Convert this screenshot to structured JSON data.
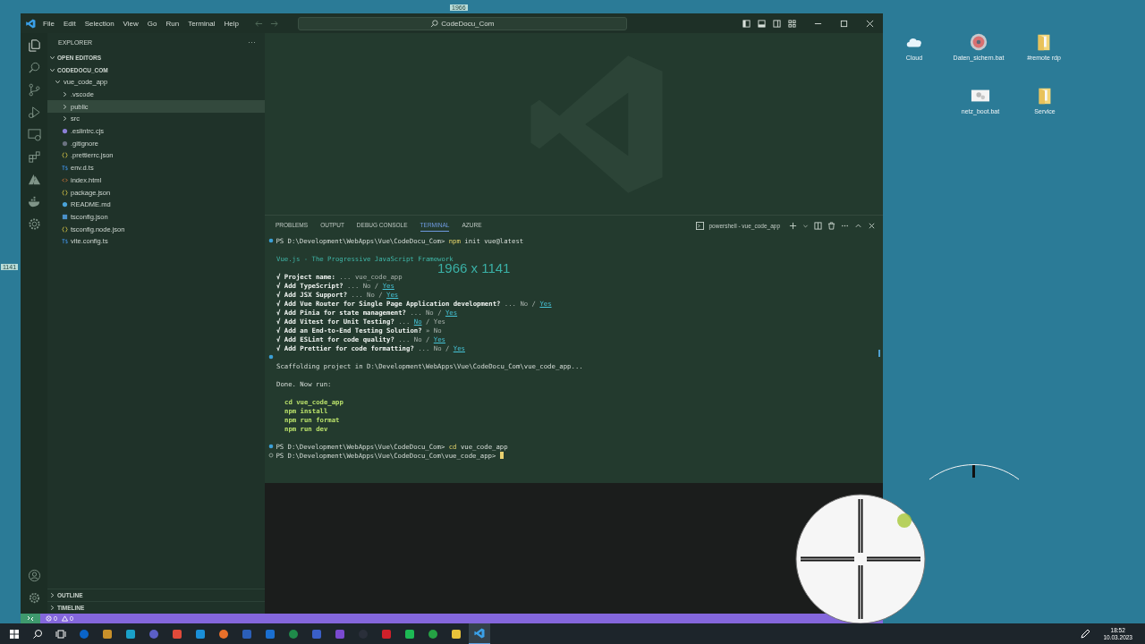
{
  "window": {
    "menu": [
      "File",
      "Edit",
      "Selection",
      "View",
      "Go",
      "Run",
      "Terminal",
      "Help"
    ],
    "command_center": "CodeDocu_Com"
  },
  "sidebar": {
    "title": "EXPLORER",
    "more": "···",
    "sections": [
      {
        "title": "OPEN EDITORS",
        "expanded": true
      },
      {
        "title": "CODEDOCU_COM",
        "expanded": true,
        "tree": [
          {
            "label": "vue_code_app",
            "kind": "folder",
            "expanded": true,
            "selected": false,
            "children": [
              {
                "label": ".vscode",
                "kind": "folder",
                "expanded": false,
                "selected": false
              },
              {
                "label": "public",
                "kind": "folder",
                "expanded": false,
                "selected": true
              },
              {
                "label": "src",
                "kind": "folder",
                "expanded": false,
                "selected": false
              },
              {
                "label": ".eslintrc.cjs",
                "kind": "eslint",
                "selected": false
              },
              {
                "label": ".gitignore",
                "kind": "git",
                "selected": false
              },
              {
                "label": ".prettierrc.json",
                "kind": "braces",
                "selected": false
              },
              {
                "label": "env.d.ts",
                "kind": "ts",
                "selected": false
              },
              {
                "label": "index.html",
                "kind": "html",
                "selected": false
              },
              {
                "label": "package.json",
                "kind": "braces",
                "selected": false
              },
              {
                "label": "README.md",
                "kind": "info",
                "selected": false
              },
              {
                "label": "tsconfig.json",
                "kind": "tsconfig",
                "selected": false
              },
              {
                "label": "tsconfig.node.json",
                "kind": "braces",
                "selected": false
              },
              {
                "label": "vite.config.ts",
                "kind": "ts",
                "selected": false
              }
            ]
          }
        ]
      }
    ],
    "bottom_sections": [
      {
        "title": "OUTLINE",
        "expanded": false
      },
      {
        "title": "TIMELINE",
        "expanded": false
      }
    ]
  },
  "panel": {
    "tabs": [
      {
        "label": "PROBLEMS",
        "selected": false
      },
      {
        "label": "OUTPUT",
        "selected": false
      },
      {
        "label": "DEBUG CONSOLE",
        "selected": false
      },
      {
        "label": "TERMINAL",
        "selected": true
      },
      {
        "label": "AZURE",
        "selected": false
      }
    ],
    "terminal_name": "powershell - vue_code_app",
    "lines": [
      {
        "kind": "prompt",
        "finished": true,
        "text": "PS D:\\Development\\WebApps\\Vue\\CodeDocu_Com>",
        "program": "npm",
        "args": "init vue@latest"
      },
      {
        "kind": "blank"
      },
      {
        "kind": "info",
        "text": "Vue.js - The Progressive JavaScript Framework"
      },
      {
        "kind": "blank"
      },
      {
        "kind": "answer",
        "mark": "√",
        "question": "Project name:",
        "answer": "... vue_code_app"
      },
      {
        "kind": "choice",
        "mark": "√",
        "question": "Add TypeScript?",
        "prefix": "...",
        "separator": "/",
        "options": [
          {
            "label": "No",
            "selected": false
          },
          {
            "label": "Yes",
            "selected": true
          }
        ]
      },
      {
        "kind": "choice",
        "mark": "√",
        "question": "Add JSX Support?",
        "prefix": "...",
        "separator": "/",
        "options": [
          {
            "label": "No",
            "selected": false
          },
          {
            "label": "Yes",
            "selected": true
          }
        ]
      },
      {
        "kind": "choice",
        "mark": "√",
        "question": "Add Vue Router for Single Page Application development?",
        "prefix": "...",
        "separator": "/",
        "options": [
          {
            "label": "No",
            "selected": false
          },
          {
            "label": "Yes",
            "selected": true
          }
        ]
      },
      {
        "kind": "choice",
        "mark": "√",
        "question": "Add Pinia for state management?",
        "prefix": "...",
        "separator": "/",
        "options": [
          {
            "label": "No",
            "selected": false
          },
          {
            "label": "Yes",
            "selected": true
          }
        ]
      },
      {
        "kind": "choice",
        "mark": "√",
        "question": "Add Vitest for Unit Testing?",
        "prefix": "...",
        "separator": "/",
        "options": [
          {
            "label": "No",
            "selected": true
          },
          {
            "label": "Yes",
            "selected": false
          }
        ]
      },
      {
        "kind": "answer",
        "mark": "√",
        "question": "Add an End-to-End Testing Solution?",
        "answer": "» No"
      },
      {
        "kind": "choice",
        "mark": "√",
        "question": "Add ESLint for code quality?",
        "prefix": "...",
        "separator": "/",
        "options": [
          {
            "label": "No",
            "selected": false
          },
          {
            "label": "Yes",
            "selected": true
          }
        ]
      },
      {
        "kind": "choice",
        "mark": "√",
        "question": "Add Prettier for code formatting?",
        "prefix": "...",
        "separator": "/",
        "options": [
          {
            "label": "No",
            "selected": false
          },
          {
            "label": "Yes",
            "selected": true
          }
        ]
      },
      {
        "kind": "blank",
        "finished": true
      },
      {
        "kind": "plain",
        "text": "Scaffolding project in D:\\Development\\WebApps\\Vue\\CodeDocu_Com\\vue_code_app..."
      },
      {
        "kind": "blank"
      },
      {
        "kind": "plain",
        "text": "Done. Now run:"
      },
      {
        "kind": "blank"
      },
      {
        "kind": "command",
        "text": "cd vue_code_app"
      },
      {
        "kind": "command",
        "text": "npm install"
      },
      {
        "kind": "command",
        "text": "npm run format"
      },
      {
        "kind": "command",
        "text": "npm run dev"
      },
      {
        "kind": "blank"
      },
      {
        "kind": "prompt",
        "finished": true,
        "text": "PS D:\\Development\\WebApps\\Vue\\CodeDocu_Com>",
        "program": "cd",
        "args": "vue_code_app"
      },
      {
        "kind": "prompt",
        "finished": false,
        "text": "PS D:\\Development\\WebApps\\Vue\\CodeDocu_Com\\vue_code_app>",
        "cursor": true
      }
    ]
  },
  "status_bar": {
    "errors": "0",
    "warnings": "0"
  },
  "overlay": {
    "size_label": "1966 x 1141",
    "width_tag": "1966",
    "height_tag": "1141"
  },
  "desktop_icons": [
    {
      "label": "Cloud",
      "kind": "cloud"
    },
    {
      "label": "Daten_sichern.bat",
      "kind": "disc"
    },
    {
      "label": "#remote rdp",
      "kind": "folder"
    },
    {
      "label": "netz_boot.bat",
      "kind": "gears"
    },
    {
      "label": "Service",
      "kind": "folder"
    }
  ],
  "taskbar": {
    "time": "18:52",
    "date": "10.03.2023"
  }
}
